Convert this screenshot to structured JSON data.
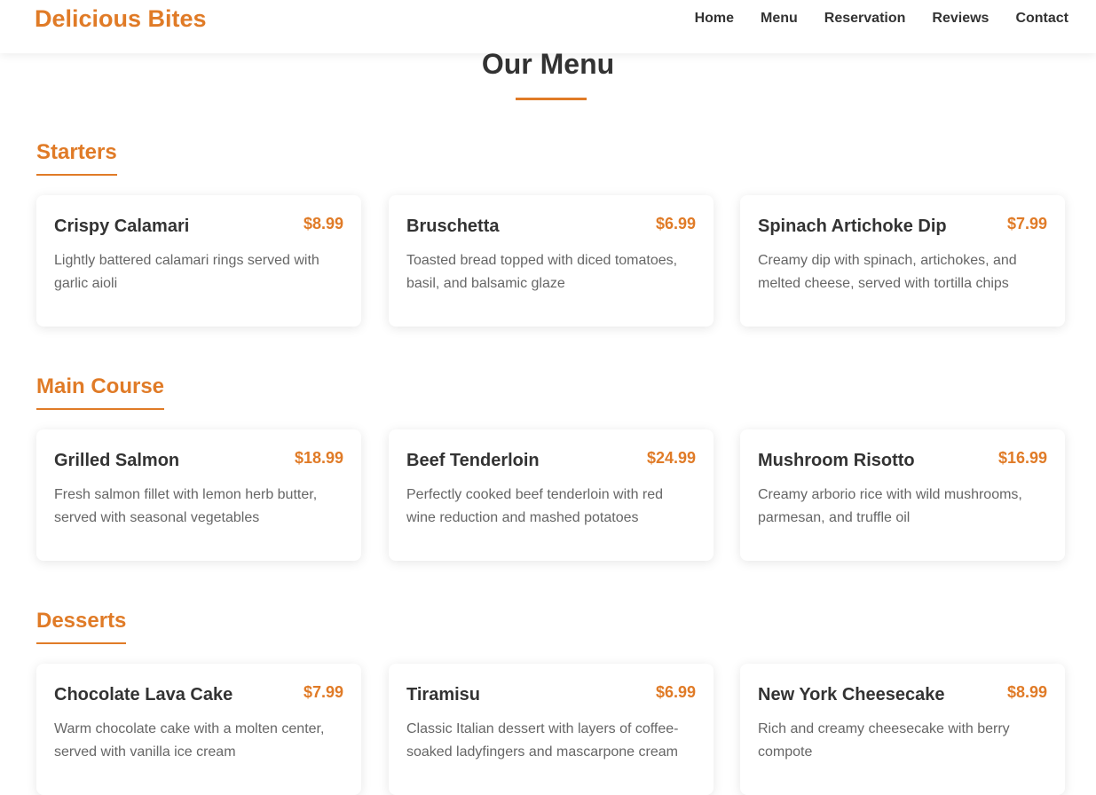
{
  "nav": {
    "brand": "Delicious Bites",
    "links": [
      "Home",
      "Menu",
      "Reservation",
      "Reviews",
      "Contact"
    ]
  },
  "page": {
    "title": "Our Menu"
  },
  "colors": {
    "accent": "#e07b27",
    "text": "#333333",
    "muted": "#666666"
  },
  "sections": [
    {
      "title": "Starters",
      "items": [
        {
          "name": "Crispy Calamari",
          "price": "$8.99",
          "desc": "Lightly battered calamari rings served with garlic aioli"
        },
        {
          "name": "Bruschetta",
          "price": "$6.99",
          "desc": "Toasted bread topped with diced tomatoes, basil, and balsamic glaze"
        },
        {
          "name": "Spinach Artichoke Dip",
          "price": "$7.99",
          "desc": "Creamy dip with spinach, artichokes, and melted cheese, served with tortilla chips"
        }
      ]
    },
    {
      "title": "Main Course",
      "items": [
        {
          "name": "Grilled Salmon",
          "price": "$18.99",
          "desc": "Fresh salmon fillet with lemon herb butter, served with seasonal vegetables"
        },
        {
          "name": "Beef Tenderloin",
          "price": "$24.99",
          "desc": "Perfectly cooked beef tenderloin with red wine reduction and mashed potatoes"
        },
        {
          "name": "Mushroom Risotto",
          "price": "$16.99",
          "desc": "Creamy arborio rice with wild mushrooms, parmesan, and truffle oil"
        }
      ]
    },
    {
      "title": "Desserts",
      "items": [
        {
          "name": "Chocolate Lava Cake",
          "price": "$7.99",
          "desc": "Warm chocolate cake with a molten center, served with vanilla ice cream"
        },
        {
          "name": "Tiramisu",
          "price": "$6.99",
          "desc": "Classic Italian dessert with layers of coffee-soaked ladyfingers and mascarpone cream"
        },
        {
          "name": "New York Cheesecake",
          "price": "$8.99",
          "desc": "Rich and creamy cheesecake with berry compote"
        }
      ]
    }
  ]
}
